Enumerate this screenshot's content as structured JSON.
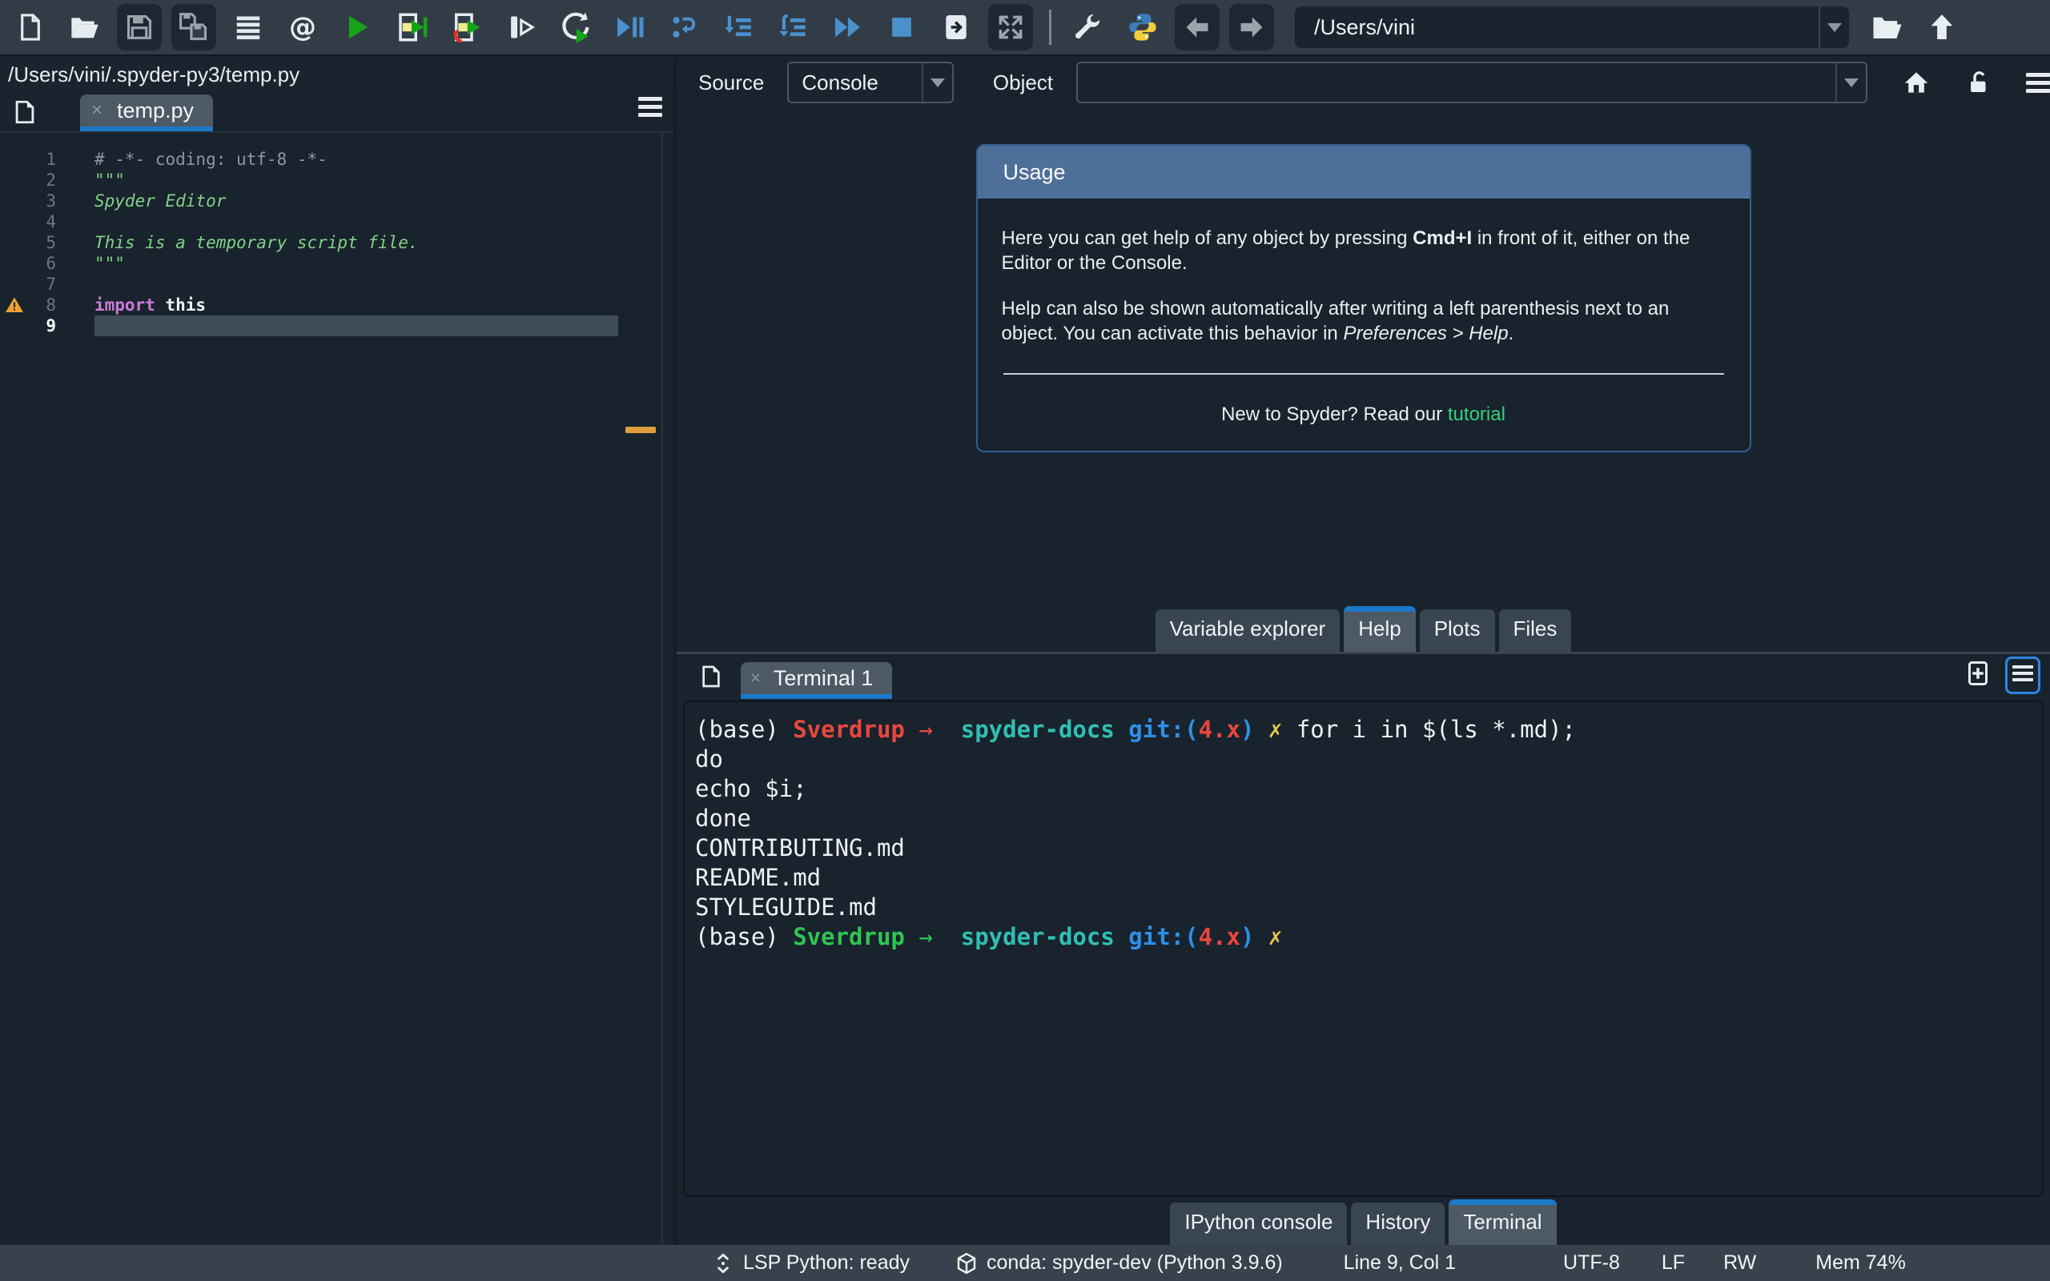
{
  "colors": {
    "accent_blue": "#1c78c8",
    "usage_header_blue": "#4d6f99",
    "link_green": "#37d07e",
    "warning_orange": "#f0a32e",
    "term_red": "#e8473f",
    "term_green": "#2fc552",
    "term_teal": "#30bfb3",
    "term_blue": "#2e8fe8",
    "term_yellow": "#e2c84b"
  },
  "toolbar": {
    "path_value": "/Users/vini",
    "buttons": [
      {
        "name": "new-file-icon",
        "boxed": false
      },
      {
        "name": "open-file-icon",
        "boxed": false
      },
      {
        "name": "save-icon",
        "boxed": true
      },
      {
        "name": "save-all-icon",
        "boxed": true
      },
      {
        "name": "file-switcher-icon",
        "boxed": false
      },
      {
        "name": "find-symbol-icon",
        "boxed": false
      },
      {
        "name": "run-file-icon",
        "boxed": false
      },
      {
        "name": "run-cell-icon",
        "boxed": false
      },
      {
        "name": "run-cell-advance-icon",
        "boxed": false
      },
      {
        "name": "run-selection-icon",
        "boxed": false
      },
      {
        "name": "rerun-cell-icon",
        "boxed": false
      },
      {
        "name": "debug-file-icon",
        "boxed": false
      },
      {
        "name": "debug-run-line-icon",
        "boxed": false
      },
      {
        "name": "debug-step-into-icon",
        "boxed": false
      },
      {
        "name": "debug-step-return-icon",
        "boxed": false
      },
      {
        "name": "debug-continue-icon",
        "boxed": false
      },
      {
        "name": "debug-stop-icon",
        "boxed": false
      },
      {
        "name": "maximize-pane-icon",
        "boxed": false
      },
      {
        "name": "fullscreen-icon",
        "boxed": true
      },
      {
        "sep": true
      },
      {
        "name": "preferences-icon",
        "boxed": false
      },
      {
        "name": "python-env-icon",
        "boxed": false
      },
      {
        "name": "back-icon",
        "boxed": true
      },
      {
        "name": "forward-icon",
        "boxed": true
      }
    ],
    "right_icons": [
      "open-directory-icon",
      "parent-directory-icon"
    ]
  },
  "editor": {
    "breadcrumb": "/Users/vini/.spyder-py3/temp.py",
    "tab_label": "temp.py",
    "tab_close": "×",
    "lines": [
      {
        "num": "1",
        "segments": [
          {
            "t": "# -*- coding: utf-8 -*-",
            "c": "comment"
          }
        ]
      },
      {
        "num": "2",
        "segments": [
          {
            "t": "\"\"\"",
            "c": "string"
          }
        ]
      },
      {
        "num": "3",
        "segments": [
          {
            "t": "Spyder Editor",
            "c": "string-i"
          }
        ]
      },
      {
        "num": "4",
        "segments": []
      },
      {
        "num": "5",
        "segments": [
          {
            "t": "This is a temporary script file.",
            "c": "string-i"
          }
        ]
      },
      {
        "num": "6",
        "segments": [
          {
            "t": "\"\"\"",
            "c": "string"
          }
        ]
      },
      {
        "num": "7",
        "segments": []
      },
      {
        "num": "8",
        "warning": true,
        "segments": [
          {
            "t": "import",
            "c": "kw"
          },
          {
            "t": " this",
            "c": "plain"
          }
        ]
      },
      {
        "num": "9",
        "current": true,
        "segments": []
      }
    ]
  },
  "help": {
    "source_label": "Source",
    "source_value": "Console",
    "object_label": "Object",
    "object_value": "",
    "usage": {
      "title": "Usage",
      "p1_pre": "Here you can get help of any object by pressing ",
      "p1_bold": "Cmd+I",
      "p1_post": " in front of it, either on the Editor or the Console.",
      "p2_pre": "Help can also be shown automatically after writing a left parenthesis next to an object. You can activate this behavior in ",
      "p2_italic": "Preferences > Help",
      "p2_post": ".",
      "footer_pre": "New to Spyder? Read our ",
      "footer_link": "tutorial"
    },
    "tabs": [
      {
        "label": "Variable explorer",
        "active": false
      },
      {
        "label": "Help",
        "active": true
      },
      {
        "label": "Plots",
        "active": false
      },
      {
        "label": "Files",
        "active": false
      }
    ]
  },
  "terminal": {
    "tab_label": "Terminal 1",
    "tab_close": "×",
    "lines": [
      [
        {
          "t": "(base) ",
          "c": "w"
        },
        {
          "t": "Sverdrup",
          "c": "red",
          "b": true
        },
        {
          "t": " →",
          "c": "red"
        },
        {
          "t": "  ",
          "c": "w"
        },
        {
          "t": "spyder-docs",
          "c": "teal",
          "b": true
        },
        {
          "t": " git:(",
          "c": "blue",
          "b": true
        },
        {
          "t": "4.x",
          "c": "red",
          "b": true
        },
        {
          "t": ")",
          "c": "blue",
          "b": true
        },
        {
          "t": " ✗",
          "c": "yellow"
        },
        {
          "t": " for i in $(ls *.md);",
          "c": "w"
        }
      ],
      [
        {
          "t": "do",
          "c": "w"
        }
      ],
      [
        {
          "t": "echo $i;",
          "c": "w"
        }
      ],
      [
        {
          "t": "done",
          "c": "w"
        }
      ],
      [
        {
          "t": "CONTRIBUTING.md",
          "c": "w"
        }
      ],
      [
        {
          "t": "README.md",
          "c": "w"
        }
      ],
      [
        {
          "t": "STYLEGUIDE.md",
          "c": "w"
        }
      ],
      [
        {
          "t": "(base) ",
          "c": "w"
        },
        {
          "t": "Sverdrup",
          "c": "green",
          "b": true
        },
        {
          "t": " →",
          "c": "green"
        },
        {
          "t": "  ",
          "c": "w"
        },
        {
          "t": "spyder-docs",
          "c": "teal",
          "b": true
        },
        {
          "t": " git:(",
          "c": "blue",
          "b": true
        },
        {
          "t": "4.x",
          "c": "red",
          "b": true
        },
        {
          "t": ")",
          "c": "blue",
          "b": true
        },
        {
          "t": " ✗",
          "c": "yellow"
        }
      ]
    ],
    "bottom_tabs": [
      {
        "label": "IPython console",
        "active": false
      },
      {
        "label": "History",
        "active": false
      },
      {
        "label": "Terminal",
        "active": true
      }
    ]
  },
  "statusbar": {
    "lsp": "LSP Python: ready",
    "conda": "conda: spyder-dev (Python 3.9.6)",
    "cursor": "Line 9, Col 1",
    "encoding": "UTF-8",
    "eol": "LF",
    "permissions": "RW",
    "memory": "Mem 74%"
  }
}
